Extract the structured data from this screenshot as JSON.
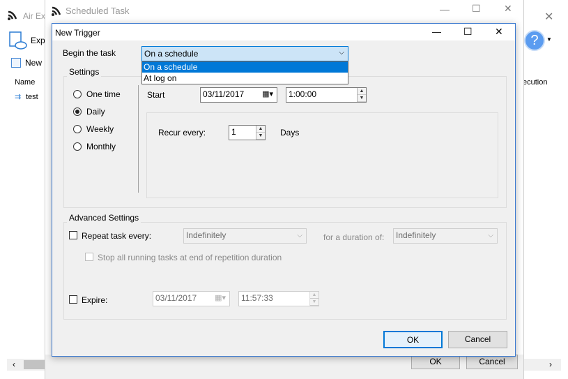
{
  "background_app": {
    "title": "Air Ex",
    "toolbar": {
      "explore_label": "Expl",
      "new_label": "New"
    },
    "table": {
      "name_header": "Name",
      "execution_header": "ecution",
      "row_name": "test"
    }
  },
  "scheduled_task_window": {
    "title": "Scheduled Task",
    "ok_label": "OK",
    "cancel_label": "Cancel"
  },
  "dialog": {
    "title": "New Trigger",
    "begin_task_label": "Begin the task",
    "begin_task_value": "On a schedule",
    "begin_task_options": [
      "On a schedule",
      "At log on"
    ],
    "settings": {
      "label": "Settings",
      "options": [
        "One time",
        "Daily",
        "Weekly",
        "Monthly"
      ],
      "selected": "Daily",
      "start_label": "Start",
      "start_date": "03/11/2017",
      "start_time": "1:00:00",
      "recur_label": "Recur every:",
      "recur_value": "1",
      "recur_unit": "Days"
    },
    "advanced": {
      "label": "Advanced Settings",
      "repeat_label": "Repeat task every:",
      "repeat_value": "Indefinitely",
      "duration_label": "for a duration of:",
      "duration_value": "Indefinitely",
      "stop_label": "Stop all running tasks at end of repetition duration",
      "expire_label": "Expire:",
      "expire_date": "03/11/2017",
      "expire_time": "11:57:33"
    },
    "ok_label": "OK",
    "cancel_label": "Cancel"
  },
  "colors": {
    "accent": "#0078d7",
    "dialog_bg": "#f0f0f0",
    "dropdown_selected": "#0078d7",
    "combo_bg": "#cce4f7"
  }
}
